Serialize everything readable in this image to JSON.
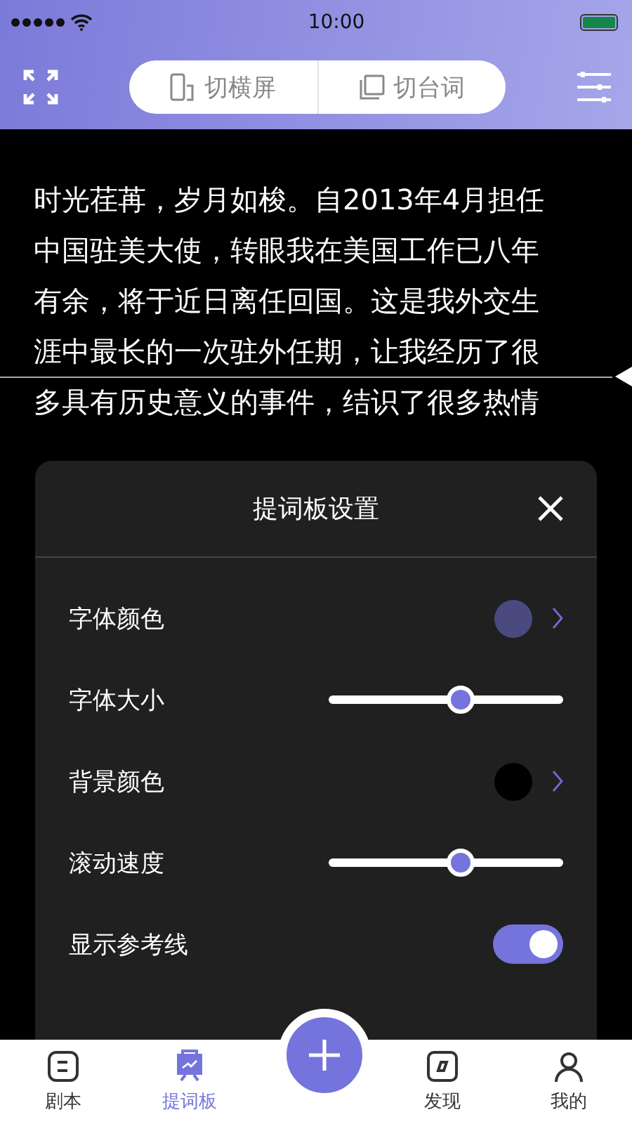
{
  "status_bar": {
    "time": "10:00"
  },
  "header": {
    "buttons": [
      {
        "label": "切横屏",
        "kind": "rotate"
      },
      {
        "label": "切台词",
        "kind": "copy"
      }
    ]
  },
  "script": {
    "lines": [
      "时光荏苒，岁月如梭。自2013年4月担任",
      "中国驻美大使，转眼我在美国工作已八年",
      "有余，将于近日离任回国。这是我外交生",
      "涯中最长的一次驻外任期，让我经历了很",
      "多具有历史意义的事件，结识了很多热情"
    ],
    "reference_line": true
  },
  "settings_panel": {
    "title": "提词板设置",
    "rows": [
      {
        "kind": "color",
        "label": "字体颜色",
        "color": "#4b4a80"
      },
      {
        "kind": "slider",
        "label": "字体大小",
        "level": 0.56
      },
      {
        "kind": "color",
        "label": "背景颜色",
        "color": "#000000"
      },
      {
        "kind": "slider",
        "label": "滚动速度",
        "level": 0.56
      },
      {
        "kind": "toggle",
        "label": "显示参考线",
        "on": true
      }
    ]
  },
  "tab_bar": {
    "items": [
      {
        "label": "剧本",
        "kind": "script",
        "selected": false
      },
      {
        "label": "提词板",
        "kind": "board",
        "selected": true
      },
      {
        "label": "发现",
        "kind": "discover",
        "selected": false
      },
      {
        "label": "我的",
        "kind": "me",
        "selected": false
      }
    ]
  }
}
